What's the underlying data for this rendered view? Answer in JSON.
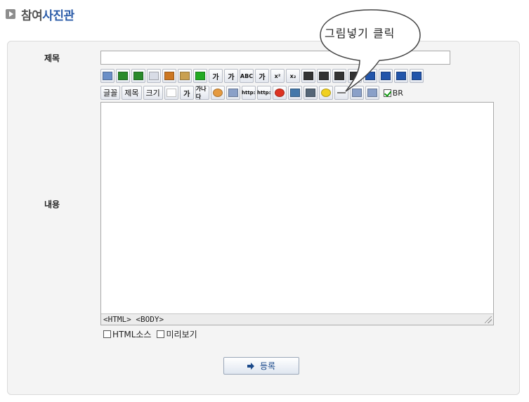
{
  "page": {
    "title_part1": "참여",
    "title_part2": "사진관"
  },
  "form": {
    "subject_label": "제목",
    "content_label": "내용",
    "subject_value": ""
  },
  "toolbar1": [
    {
      "name": "print-icon",
      "label": ""
    },
    {
      "name": "undo-icon",
      "label": ""
    },
    {
      "name": "redo-icon",
      "label": ""
    },
    {
      "name": "copy-icon",
      "label": ""
    },
    {
      "name": "cut-icon",
      "label": ""
    },
    {
      "name": "paste-icon",
      "label": ""
    },
    {
      "name": "spellcheck-icon",
      "label": ""
    },
    {
      "name": "bold-icon",
      "label": "가"
    },
    {
      "name": "underline-icon",
      "label": "가"
    },
    {
      "name": "strikethrough-icon",
      "label": "ABC"
    },
    {
      "name": "italic-icon",
      "label": "가"
    },
    {
      "name": "superscript-icon",
      "label": "x²"
    },
    {
      "name": "subscript-icon",
      "label": "x₂"
    },
    {
      "name": "align-left-icon",
      "label": ""
    },
    {
      "name": "align-center-icon",
      "label": ""
    },
    {
      "name": "align-right-icon",
      "label": ""
    },
    {
      "name": "align-justify-icon",
      "label": ""
    },
    {
      "name": "ordered-list-icon",
      "label": ""
    },
    {
      "name": "unordered-list-icon",
      "label": ""
    },
    {
      "name": "outdent-icon",
      "label": ""
    },
    {
      "name": "indent-icon",
      "label": ""
    }
  ],
  "toolbar2": {
    "font_label": "글꼴",
    "heading_label": "제목",
    "size_label": "크기",
    "buttons": [
      {
        "name": "box-icon",
        "label": ""
      },
      {
        "name": "highlight-icon",
        "label": "가"
      },
      {
        "name": "font-color-icon",
        "label": "가나다"
      },
      {
        "name": "color-palette-icon",
        "label": ""
      },
      {
        "name": "table-cell-icon",
        "label": ""
      },
      {
        "name": "link-icon",
        "label": "http:"
      },
      {
        "name": "unlink-icon",
        "label": "http:"
      },
      {
        "name": "flash-icon",
        "label": ""
      },
      {
        "name": "media-icon",
        "label": ""
      },
      {
        "name": "insert-image-icon",
        "label": ""
      },
      {
        "name": "emoticon-icon",
        "label": ""
      },
      {
        "name": "horizontal-rule-icon",
        "label": ""
      },
      {
        "name": "table-icon",
        "label": ""
      },
      {
        "name": "layer-icon",
        "label": ""
      }
    ],
    "br_label": "BR",
    "br_checked": true
  },
  "editor": {
    "status_text": "<HTML> <BODY>"
  },
  "options": {
    "html_source_label": "HTML소스",
    "preview_label": "미리보기"
  },
  "submit": {
    "label": "등록"
  },
  "callout": {
    "text": "그림넣기 클릭"
  },
  "colors": {
    "accent": "#2a5ba8",
    "panel_bg": "#f4f4f4"
  }
}
